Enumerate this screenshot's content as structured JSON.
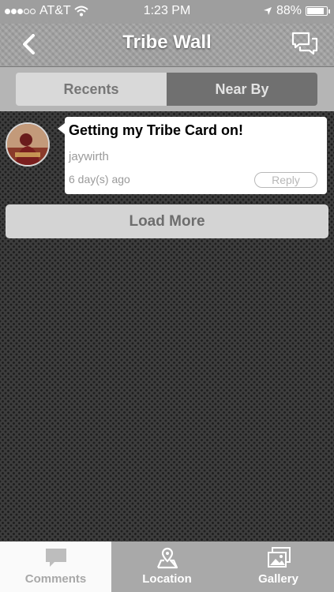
{
  "status_bar": {
    "carrier": "AT&T",
    "time": "1:23 PM",
    "battery": "88%",
    "signal_bars_filled": 3,
    "signal_bars_total": 5
  },
  "nav": {
    "title": "Tribe Wall",
    "back_icon": "chevron-left-icon",
    "chat_icon": "chat-bubbles-icon"
  },
  "segments": {
    "recents": "Recents",
    "near_by": "Near By",
    "selected": "Near By"
  },
  "posts": [
    {
      "text": "Getting my Tribe Card on!",
      "user": "jaywirth",
      "time": "6 day(s) ago",
      "reply_label": "Reply"
    }
  ],
  "load_more": "Load More",
  "tabs": [
    {
      "label": "Comments",
      "icon": "comment-icon",
      "active": true
    },
    {
      "label": "Location",
      "icon": "map-pin-icon",
      "active": false
    },
    {
      "label": "Gallery",
      "icon": "gallery-icon",
      "active": false
    }
  ],
  "colors": {
    "nav_bg": "#a3a3a3",
    "segment_selected": "#707070",
    "segment_unselected": "#d9d9d9",
    "tab_active_bg": "#fafafa",
    "tab_inactive_bg": "#a9a9a9"
  }
}
